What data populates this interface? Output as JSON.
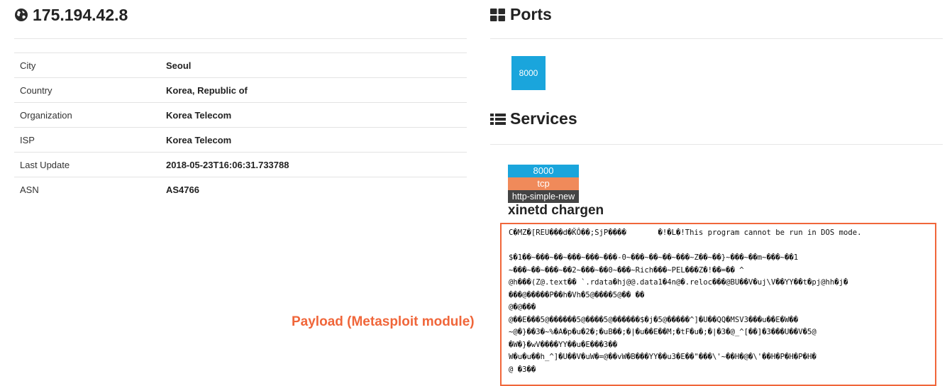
{
  "host": {
    "ip": "175.194.42.8",
    "icon": "globe-icon"
  },
  "info_rows": [
    {
      "label": "City",
      "value": "Seoul"
    },
    {
      "label": "Country",
      "value": "Korea, Republic of"
    },
    {
      "label": "Organization",
      "value": "Korea Telecom"
    },
    {
      "label": "ISP",
      "value": "Korea Telecom"
    },
    {
      "label": "Last Update",
      "value": "2018-05-23T16:06:31.733788"
    },
    {
      "label": "ASN",
      "value": "AS4766"
    }
  ],
  "ports": {
    "title": "Ports",
    "icon": "th-large-icon",
    "items": [
      "8000"
    ]
  },
  "services": {
    "title": "Services",
    "icon": "list-icon",
    "service": {
      "port": "8000",
      "protocol": "tcp",
      "module": "http-simple-new",
      "title": "xinetd chargen",
      "payload_lines": [
        "C�MZ�[REU���d�ǨÔ��;SjP����       �!�L�!This program cannot be run in DOS mode.",
        "",
        "$�1��~���~��~���~���~���-0~���~��~��~���~Z��~��}~���~��m~���~��1",
        "~���~��~���~��2~���~��0~���~Rich���~PEL���Z�!��=�� ^",
        "@h���(Z@.text�� `.rdata�hj@@.data1�4n@�.reloc���@BU��V�uj\\V��YY��t�pj@hh�j�",
        "���@�����P��h�Vh�5@����5@�� ��",
        "@�@���",
        "@��E���5@������5@����5@������$�j�5@�����^]�U��QQ�MSV3���u��E�W��",
        "~@�}��3�~%�A�p�u�2�;�uB��;�|�u��E��M;�tF�u�;�|�3�@_^[��]�3���U��V�5@",
        "�W�}�wV����YY��u�E���3��",
        "W�u�u��h_^]�U��V�uW�=@��vW�B���YY��u3�E��\"���\\'~��H�@�\\'��H�P�H�P�H�",
        "@ �3��"
      ]
    }
  },
  "annotation": {
    "label": "Payload (Metasploit module)",
    "color": "#f0663a"
  },
  "colors": {
    "accent_blue": "#1aa5dc",
    "accent_orange": "#f08a5a",
    "dark_label": "#444444"
  }
}
